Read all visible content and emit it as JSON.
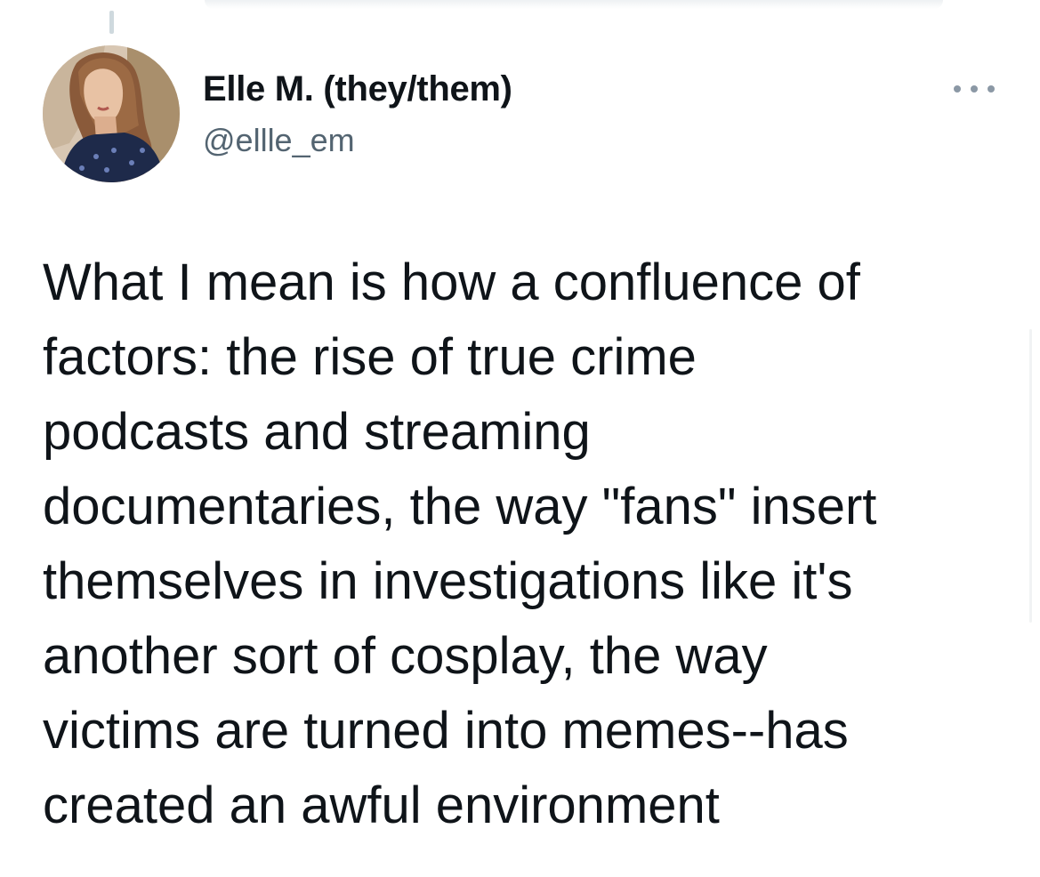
{
  "tweet": {
    "author": {
      "display_name": "Elle M. (they/them)",
      "handle": "@ellle_em",
      "avatar_alt": "avatar"
    },
    "more_icon": "more-horizontal-icon",
    "text_lines": [
      "What I mean is how a confluence of",
      "factors: the rise of true crime",
      "podcasts and streaming",
      "documentaries, the way \"fans\" insert",
      "themselves in investigations like it's",
      "another sort of cosplay, the way",
      "victims are turned into memes--has",
      "created an awful environment"
    ]
  },
  "colors": {
    "text_primary": "#0f1419",
    "text_secondary": "#536471",
    "icon_gray": "#8b98a5",
    "thread_line": "#cfd9de"
  }
}
